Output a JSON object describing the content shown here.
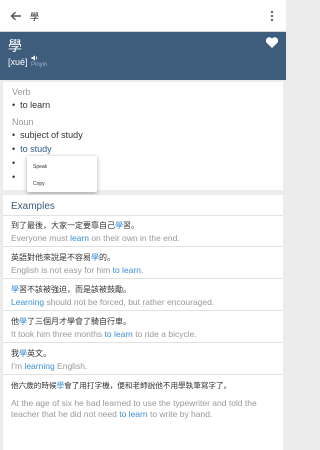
{
  "app_bar": {
    "search_query": "學"
  },
  "header": {
    "headword": "學",
    "pronunciation": "[xué]",
    "pinyin_label": "Pinyin",
    "background": "#3e5d7c"
  },
  "definitions": [
    {
      "pos": "Verb",
      "senses": [
        "to learn"
      ]
    },
    {
      "pos": "Noun",
      "senses": [
        "subject of study",
        "to study"
      ]
    }
  ],
  "context_menu": {
    "items": [
      "Speak",
      "Copy"
    ]
  },
  "examples": {
    "title": "Examples",
    "items": [
      {
        "zh": [
          "到了最後，大家一定要靠自己",
          "學",
          "習。"
        ],
        "en": [
          "Everyone must ",
          "learn",
          " on their own in the end."
        ]
      },
      {
        "zh": [
          "英語對他來說是不容易",
          "學",
          "的。"
        ],
        "en": [
          "English is not easy for him ",
          "to learn",
          "."
        ]
      },
      {
        "zh": [
          "",
          "學",
          "習不該被強迫，而是該被鼓勵。"
        ],
        "en": [
          "",
          "Learning",
          " should not be forced, but rather encouraged."
        ]
      },
      {
        "zh": [
          "他",
          "學",
          "了三個月才學會了騎自行車。"
        ],
        "en": [
          "It took him three months ",
          "to learn",
          " to ride a bicycle."
        ]
      },
      {
        "zh": [
          "我",
          "學",
          "英文。"
        ],
        "en": [
          "I'm ",
          "learning",
          " English."
        ]
      },
      {
        "zh": [
          "他六歲的時候",
          "學",
          "會了用打字機，便和老師說他不用學執筆寫字了。"
        ],
        "en": [
          "At the age of six he had learned to use the typewriter and told the teacher that he did not need ",
          "to learn",
          " to write by hand."
        ]
      }
    ]
  }
}
